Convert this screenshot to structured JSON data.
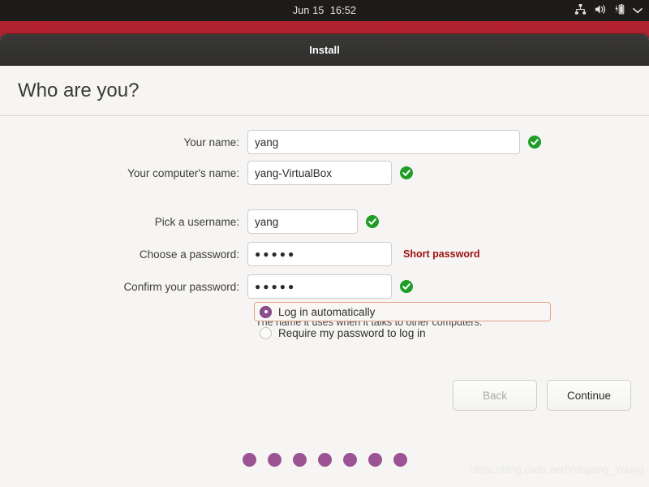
{
  "top_panel": {
    "clock": "Jun 15  16:52",
    "tray_icons": [
      "network-icon",
      "volume-icon",
      "battery-charging-icon",
      "chevron-down-icon"
    ]
  },
  "window": {
    "title": "Install"
  },
  "page": {
    "title": "Who are you?"
  },
  "form": {
    "fields": [
      {
        "label": "Your name:",
        "value": "yang",
        "valid": true
      },
      {
        "label": "Your computer's name:",
        "value": "yang-VirtualBox",
        "valid": true
      },
      {
        "label": "Pick a username:",
        "value": "yang",
        "valid": true
      },
      {
        "label": "Choose a password:",
        "value": "●●●●●",
        "warning": "Short password"
      },
      {
        "label": "Confirm your password:",
        "value": "●●●●●",
        "valid": true
      }
    ],
    "hostname_hint": "The name it uses when it talks to other computers.",
    "login_options": [
      {
        "label": "Log in automatically",
        "selected": true
      },
      {
        "label": "Require my password to log in",
        "selected": false
      }
    ]
  },
  "buttons": {
    "back": "Back",
    "continue": "Continue"
  },
  "progress": {
    "total_dots": 7
  },
  "watermark": "https://blog.csdn.net/Yungang_Young",
  "colors": {
    "accent_purple": "#9b5394",
    "radio_purple": "#8e4d8c",
    "valid_green": "#1f9d27",
    "warning_red": "#9c1010",
    "focus_ring": "#e8a188",
    "desktop_red": "#b3232f",
    "panel_dark": "#1d1c1b",
    "titlebar_dark": "#33322f"
  }
}
